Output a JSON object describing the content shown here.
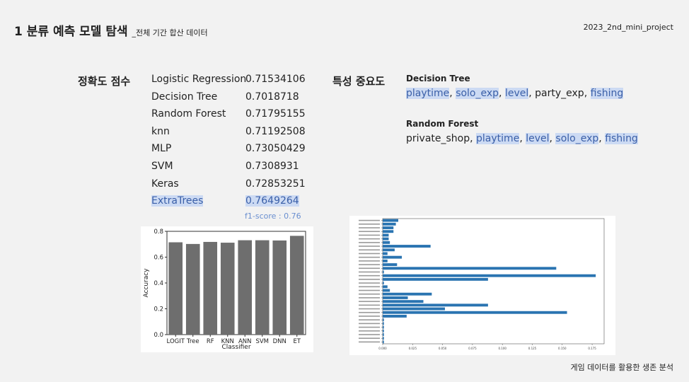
{
  "slide": {
    "title": "1 분류 예측 모델 탐색",
    "subtitle": "_전체 기간 합산 데이터",
    "project": "2023_2nd_mini_project",
    "footer": "게임 데이터를 활용한 생존 분석"
  },
  "accuracy_section": {
    "label": "정확도 점수",
    "rows": [
      {
        "model": "Logistic Regression",
        "score": "0.71534106"
      },
      {
        "model": "Decision Tree",
        "score": "0.7018718"
      },
      {
        "model": "Random Forest",
        "score": "0.71795155"
      },
      {
        "model": "knn",
        "score": "0.71192508"
      },
      {
        "model": "MLP",
        "score": "0.73050429"
      },
      {
        "model": "SVM",
        "score": "0.7308931"
      },
      {
        "model": "Keras",
        "score": "0.72853251"
      },
      {
        "model": "ExtraTrees",
        "score": "0.7649264",
        "highlight": true
      }
    ],
    "f1_note": "f1-score : 0.76"
  },
  "importance_section": {
    "label": "특성 중요도",
    "models": [
      {
        "name": "Decision Tree",
        "features": [
          {
            "text": "playtime",
            "hl": true
          },
          {
            "text": "solo_exp",
            "hl": true
          },
          {
            "text": "level",
            "hl": true
          },
          {
            "text": "party_exp",
            "hl": false
          },
          {
            "text": "fishing",
            "hl": true
          }
        ]
      },
      {
        "name": "Random Forest",
        "features": [
          {
            "text": "private_shop",
            "hl": false
          },
          {
            "text": "playtime",
            "hl": true
          },
          {
            "text": "level",
            "hl": true
          },
          {
            "text": "solo_exp",
            "hl": true
          },
          {
            "text": "fishing",
            "hl": true
          }
        ]
      }
    ]
  },
  "colors": {
    "highlight_bg": "#ccdaf3",
    "highlight_text": "#3a5fa8",
    "bar_gray": "#6e6e6e",
    "bar_blue": "#2a74b1"
  },
  "chart_data": [
    {
      "type": "bar",
      "categories": [
        "LOGIT",
        "Tree",
        "RF",
        "KNN",
        "ANN",
        "SVM",
        "DNN",
        "ET"
      ],
      "values": [
        0.715,
        0.702,
        0.718,
        0.712,
        0.731,
        0.731,
        0.729,
        0.765
      ],
      "xlabel": "Classifier",
      "ylabel": "Accuracy",
      "ylim": [
        0,
        0.8
      ],
      "yticks": [
        "0.0",
        "0.2",
        "0.4",
        "0.6",
        "0.8"
      ],
      "grid": false
    },
    {
      "type": "bar",
      "orientation": "horizontal",
      "categories": [
        "c1",
        "c2",
        "c3",
        "c4",
        "c5",
        "c6",
        "c7",
        "c8",
        "c9",
        "c10",
        "c11",
        "c12",
        "c13",
        "c14",
        "c15",
        "c16",
        "c17",
        "c18",
        "c19",
        "c20",
        "c21",
        "c22",
        "c23",
        "c24",
        "c25",
        "c26",
        "c27",
        "c28",
        "c29",
        "c30",
        "c31",
        "c32",
        "c33",
        "c34"
      ],
      "values": [
        0.013,
        0.011,
        0.009,
        0.009,
        0.005,
        0.005,
        0.006,
        0.04,
        0.01,
        0.004,
        0.016,
        0.004,
        0.012,
        0.145,
        0.001,
        0.178,
        0.088,
        0.001,
        0.004,
        0.006,
        0.041,
        0.021,
        0.034,
        0.088,
        0.052,
        0.154,
        0.02,
        0.001,
        0.001,
        0.001,
        0.001,
        0.001,
        0.001,
        0.001
      ],
      "xlim": [
        0,
        0.185
      ],
      "xticks": [
        "0.000",
        "0.025",
        "0.050",
        "0.075",
        "0.100",
        "0.125",
        "0.150",
        "0.175"
      ],
      "grid": false
    }
  ]
}
